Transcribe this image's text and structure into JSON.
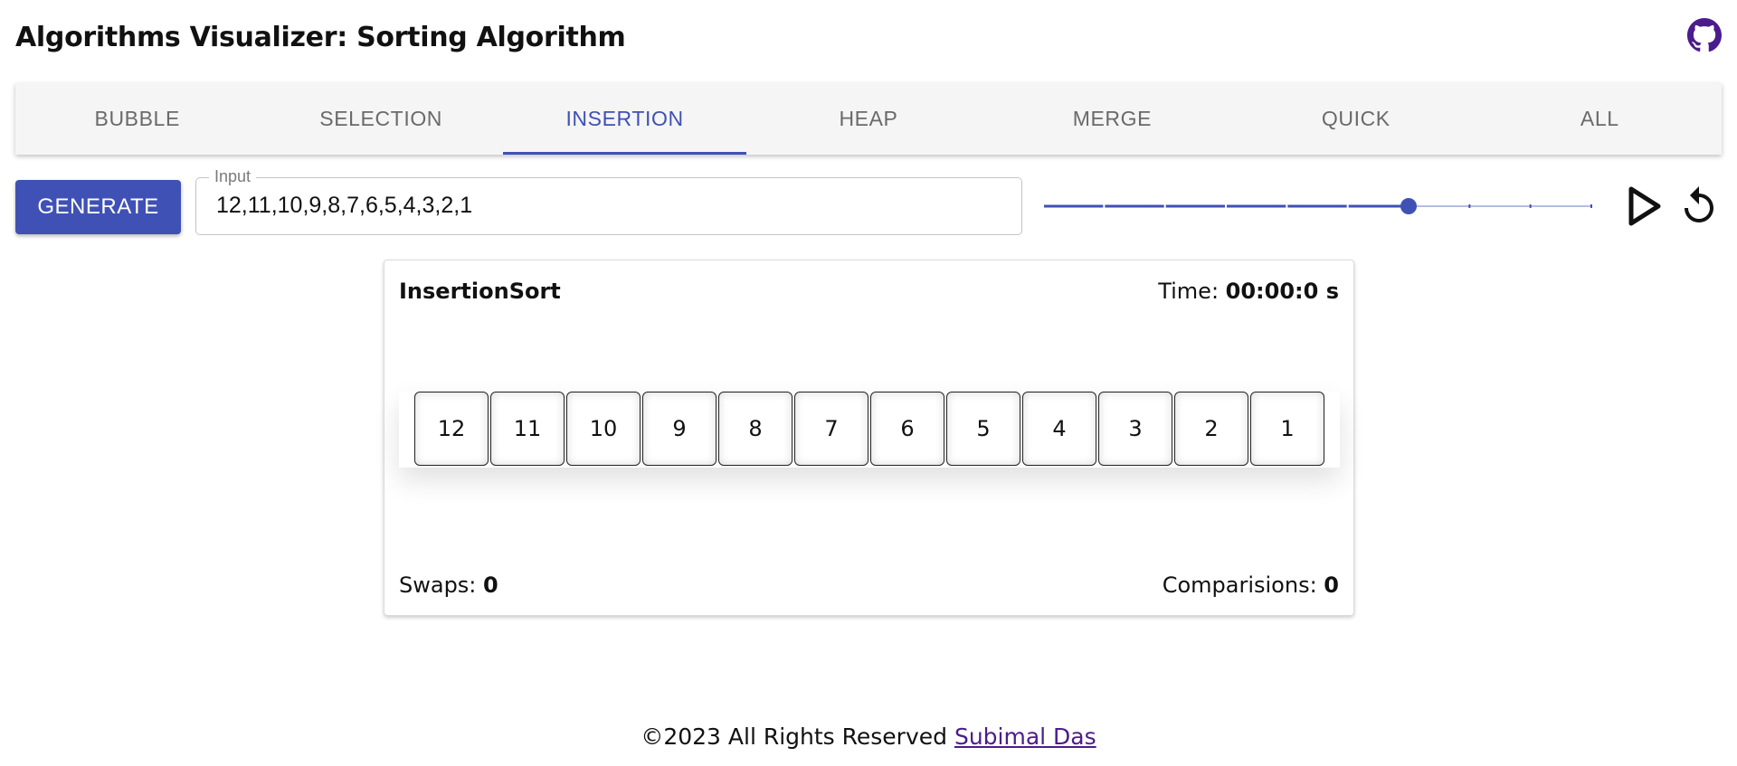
{
  "header": {
    "title": "Algorithms Visualizer: Sorting Algorithm",
    "github_icon": "github-icon"
  },
  "tabs": [
    {
      "label": "BUBBLE",
      "active": false
    },
    {
      "label": "SELECTION",
      "active": false
    },
    {
      "label": "INSERTION",
      "active": true
    },
    {
      "label": "HEAP",
      "active": false
    },
    {
      "label": "MERGE",
      "active": false
    },
    {
      "label": "QUICK",
      "active": false
    },
    {
      "label": "ALL",
      "active": false
    }
  ],
  "controls": {
    "generate_label": "GENERATE",
    "input_label": "Input",
    "input_value": "12,11,10,9,8,7,6,5,4,3,2,1",
    "speed": {
      "value": 6,
      "min": 0,
      "max": 9
    },
    "play_icon": "play-icon",
    "reset_icon": "reset-icon"
  },
  "card": {
    "algorithm": "InsertionSort",
    "time_label": "Time: ",
    "time_value": "00:00:0 s",
    "array": [
      "12",
      "11",
      "10",
      "9",
      "8",
      "7",
      "6",
      "5",
      "4",
      "3",
      "2",
      "1"
    ],
    "swaps_label": "Swaps: ",
    "swaps_value": "0",
    "comparisons_label": "Comparisions: ",
    "comparisons_value": "0"
  },
  "footer": {
    "text": "©2023 All Rights Reserved ",
    "author": "Subimal Das"
  },
  "colors": {
    "accent": "#3f51b5",
    "tab_bg": "#f5f5f5",
    "link": "#4b1c8c"
  }
}
